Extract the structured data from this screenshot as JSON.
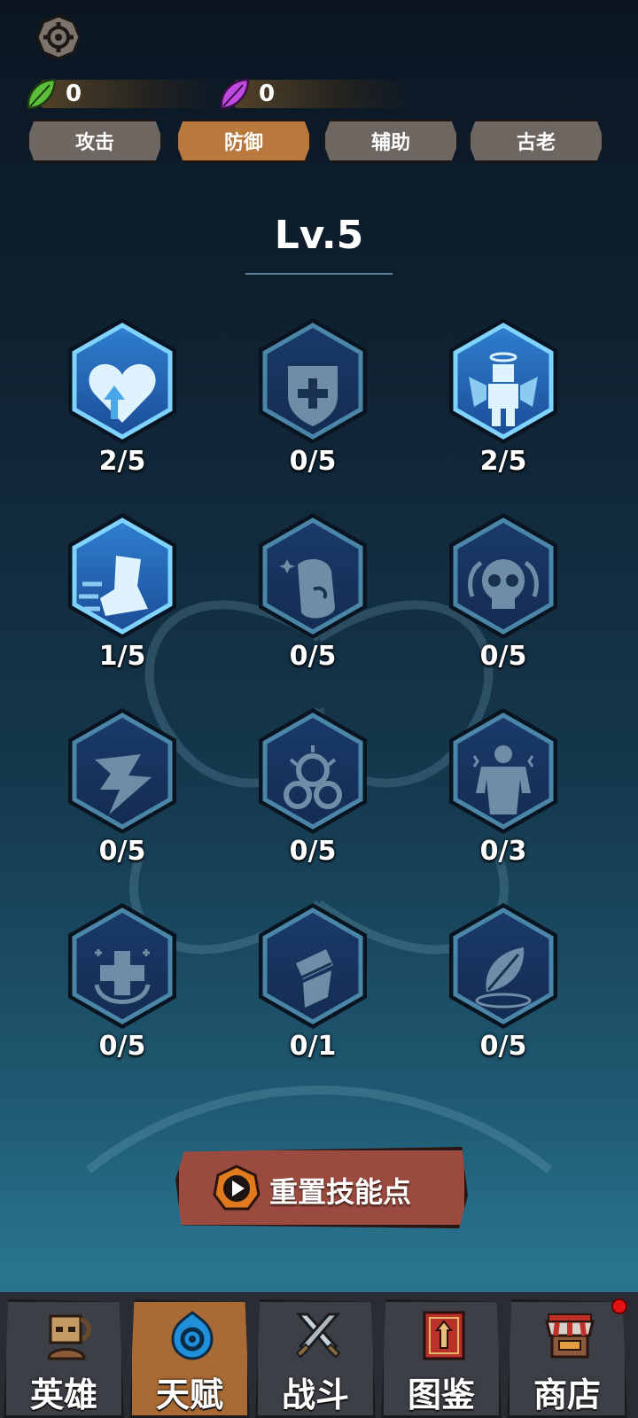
{
  "resources": [
    {
      "icon": "green-leaf-icon",
      "value": "0",
      "color": "#4caf3c"
    },
    {
      "icon": "purple-leaf-icon",
      "value": "0",
      "color": "#b23fd0"
    }
  ],
  "tabs": [
    {
      "label": "攻击",
      "active": false
    },
    {
      "label": "防御",
      "active": true
    },
    {
      "label": "辅助",
      "active": false
    },
    {
      "label": "古老",
      "active": false
    }
  ],
  "level": "Lv.5",
  "talents": [
    {
      "icon": "heart-up-icon",
      "count": "2/5",
      "unlocked": true
    },
    {
      "icon": "shield-plus-icon",
      "count": "0/5",
      "unlocked": false
    },
    {
      "icon": "angel-body-icon",
      "count": "2/5",
      "unlocked": true
    },
    {
      "icon": "speed-boot-icon",
      "count": "1/5",
      "unlocked": true
    },
    {
      "icon": "fist-sparkle-icon",
      "count": "0/5",
      "unlocked": false
    },
    {
      "icon": "skull-icon",
      "count": "0/5",
      "unlocked": false
    },
    {
      "icon": "lightning-icon",
      "count": "0/5",
      "unlocked": false
    },
    {
      "icon": "thorn-cloud-icon",
      "count": "0/5",
      "unlocked": false
    },
    {
      "icon": "giant-body-icon",
      "count": "0/3",
      "unlocked": false
    },
    {
      "icon": "heal-cross-icon",
      "count": "0/5",
      "unlocked": false
    },
    {
      "icon": "bandage-icon",
      "count": "0/1",
      "unlocked": false
    },
    {
      "icon": "leaf-ripple-icon",
      "count": "0/5",
      "unlocked": false
    }
  ],
  "reset_button": {
    "label": "重置技能点",
    "icon": "play-ad-icon"
  },
  "nav": [
    {
      "label": "英雄",
      "icon": "hero-icon",
      "active": false
    },
    {
      "label": "天赋",
      "icon": "talent-swirl-icon",
      "active": true
    },
    {
      "label": "战斗",
      "icon": "crossed-swords-icon",
      "active": false
    },
    {
      "label": "图鉴",
      "icon": "codex-book-icon",
      "active": false
    },
    {
      "label": "商店",
      "icon": "shop-stall-icon",
      "active": false,
      "badge": true
    }
  ]
}
